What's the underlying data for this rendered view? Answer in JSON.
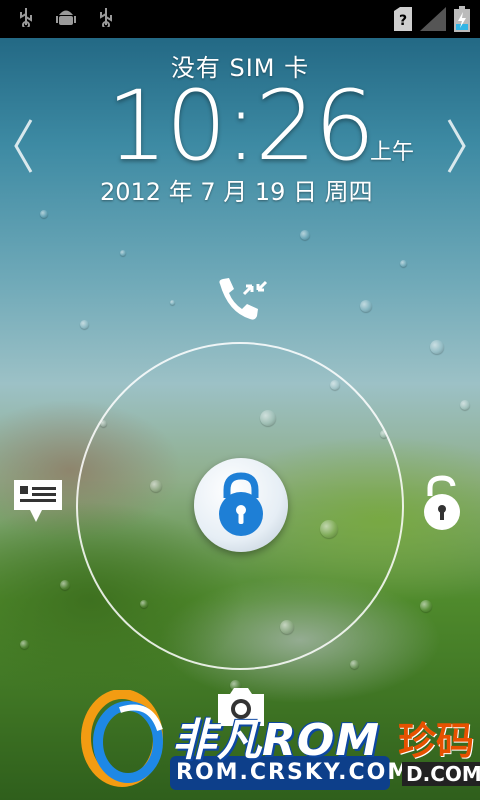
{
  "statusbar": {
    "left_icons": [
      "usb-icon",
      "android-debug-icon",
      "usb-icon"
    ],
    "right_icons": [
      "no-sim-icon",
      "signal-icon",
      "battery-charging-icon"
    ]
  },
  "lockscreen": {
    "carrier_text": "没有 SIM 卡",
    "time": "10:26",
    "ampm": "上午",
    "date": "2012 年 7 月 19 日 周四"
  },
  "targets": {
    "top": "phone-icon",
    "left": "message-icon",
    "right": "unlock-icon",
    "bottom": "camera-icon",
    "center": "lock-icon"
  },
  "watermark": {
    "brand_text": "非凡ROM",
    "site_text": "ROM.CRSKY.COM",
    "side_text": "珍码",
    "side_sub": "D.COM"
  },
  "colors": {
    "lock_blue": "#1e7fd6",
    "status_bg": "#000000"
  }
}
